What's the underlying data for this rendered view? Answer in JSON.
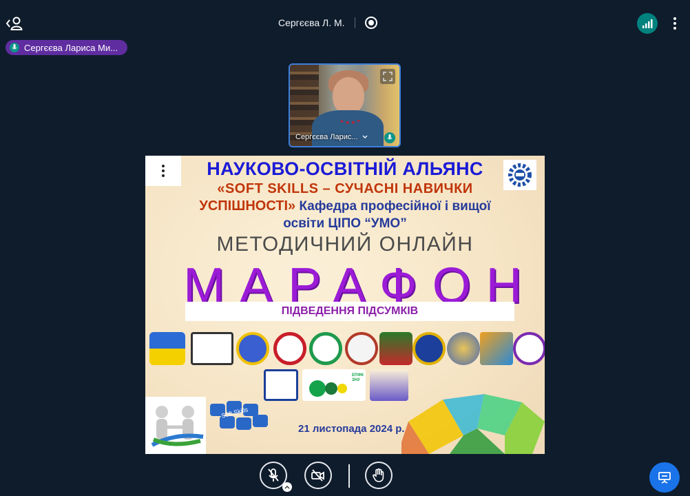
{
  "header": {
    "presenter_name": "Сергєєва Л. М.",
    "users_icon": "users-panel-icon",
    "recording_icon": "recording-indicator-icon",
    "connection_icon": "connection-status-icon",
    "options_icon": "more-options-icon"
  },
  "talking_indicator": {
    "name": "Сергєєва Лариса Ми..."
  },
  "webcam": {
    "name": "Сергєєва Ларис..."
  },
  "slide": {
    "line1": "НАУКОВО-ОСВІТНІЙ АЛЬЯНС",
    "line2": "«SOFT SKILLS – СУЧАСНІ НАВИЧКИ",
    "line3_red": "УСПІШНОСТІ»",
    "line3_blue": " Кафедра професійної і вищої",
    "line4": "освіти ЦІПО “УМО”",
    "line5": "МЕТОДИЧНИЙ ОНЛАЙН",
    "line6": "МАРАФОН",
    "subtitle": "ПІДВЕДЕННЯ ПІДСУМКІВ",
    "date": "21 листопада 2024 р.",
    "soft_skills_label": "Soft Skills",
    "epfk_label": "ЕПФК ЗНУ"
  },
  "colors": {
    "background": "#0f1c2c",
    "talker_badge": "#5f2da0",
    "accent_blue": "#1a73e8",
    "connection_green": "#00827f",
    "title_blue": "#1b1bd6",
    "title_red": "#c0350a",
    "marathon_purple": "#9b1bd6"
  },
  "controls": {
    "mic_icon": "microphone-muted-icon",
    "camera_icon": "camera-off-icon",
    "hand_icon": "raise-hand-icon",
    "presentation_icon": "presentation-icon"
  }
}
